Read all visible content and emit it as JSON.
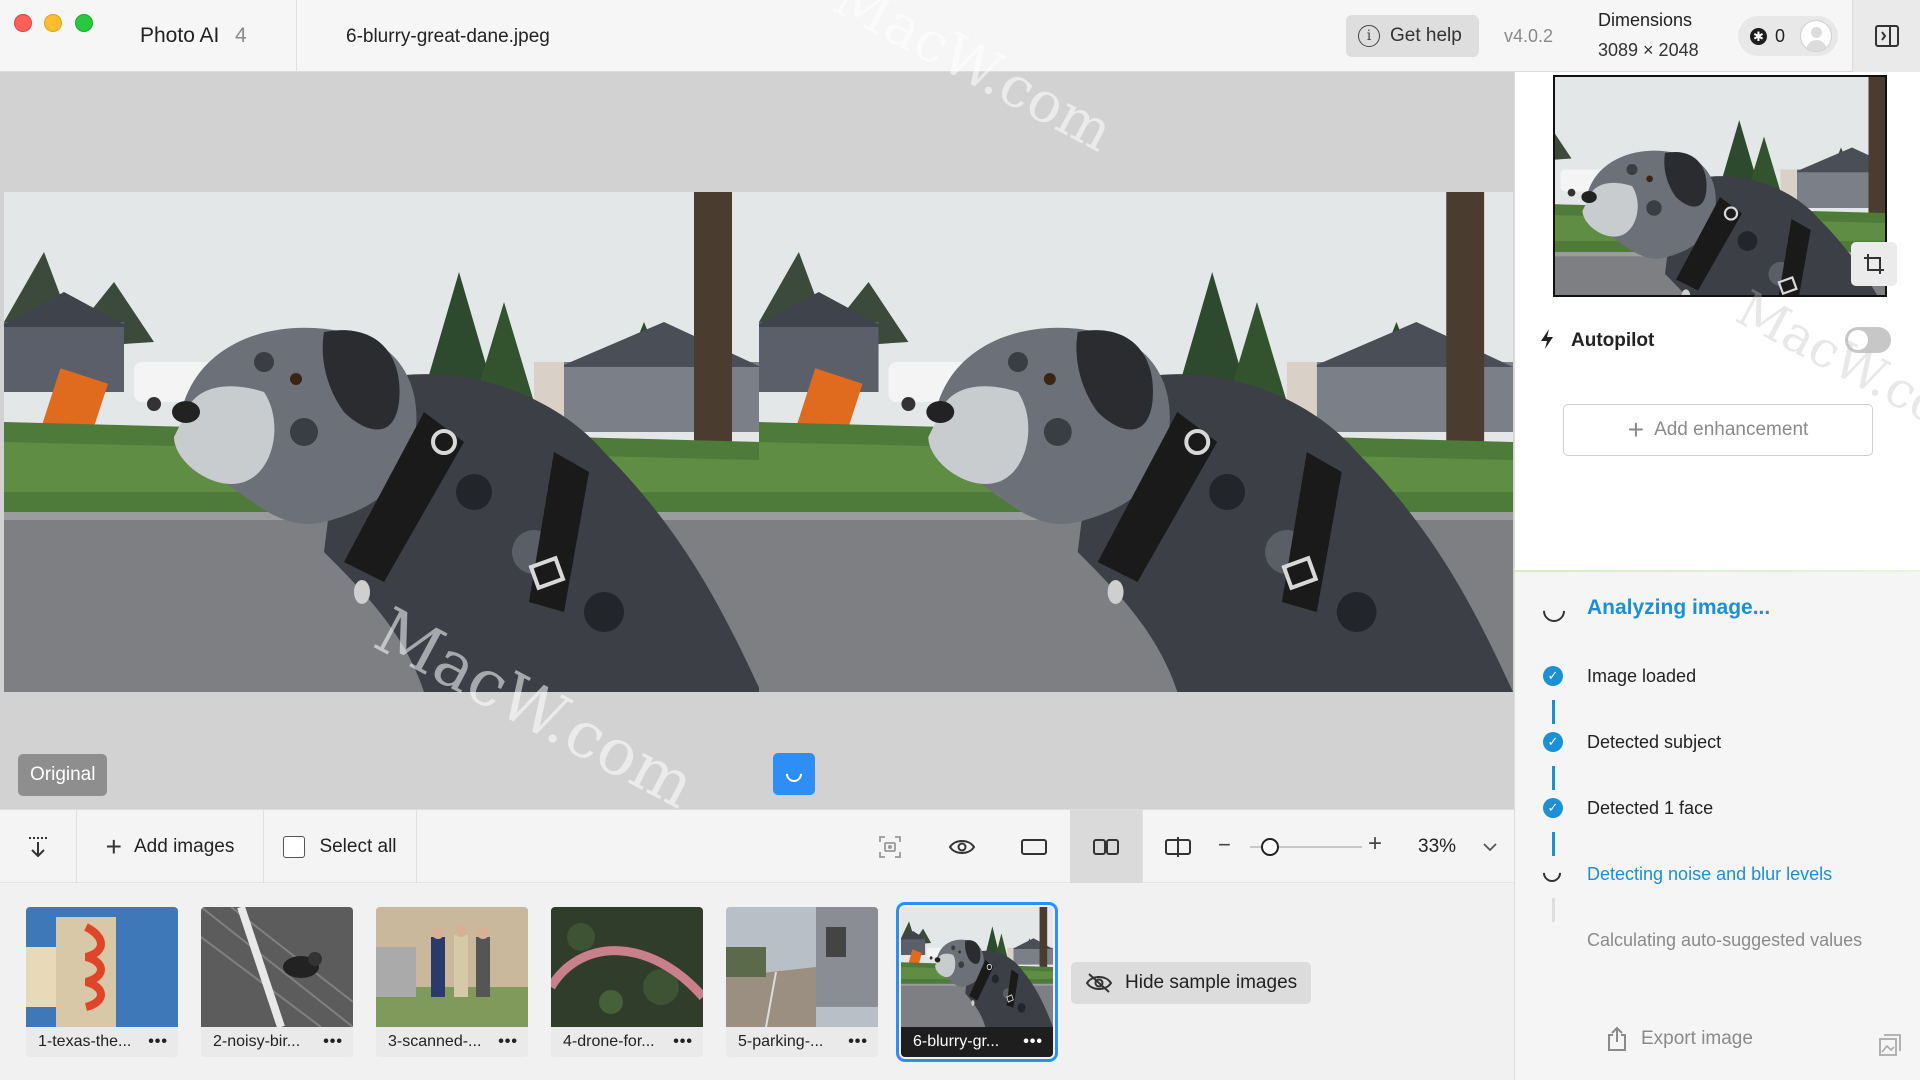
{
  "titlebar": {
    "app_name": "Photo AI",
    "app_version_badge": "4",
    "file_name": "6-blurry-great-dane.jpeg",
    "help_label": "Get help",
    "version": "v4.0.2",
    "dimensions_title": "Dimensions",
    "dimensions_value": "3089 × 2048",
    "credits": "0"
  },
  "canvas": {
    "original_label": "Original",
    "watermark_text": "MacW.com"
  },
  "toolbar": {
    "add_images_label": "Add images",
    "select_all_label": "Select all",
    "zoom_value": "33%",
    "zoom_level": 0.18
  },
  "filmstrip": {
    "thumbnails": [
      {
        "label": "1-texas-the...",
        "selected": false
      },
      {
        "label": "2-noisy-bir...",
        "selected": false
      },
      {
        "label": "3-scanned-...",
        "selected": false
      },
      {
        "label": "4-drone-for...",
        "selected": false
      },
      {
        "label": "5-parking-...",
        "selected": false
      },
      {
        "label": "6-blurry-gr...",
        "selected": true
      }
    ],
    "hide_samples_label": "Hide sample images"
  },
  "panel": {
    "autopilot_label": "Autopilot",
    "autopilot_on": false,
    "add_enhancement_label": "Add enhancement",
    "analyzing_title": "Analyzing image...",
    "steps": [
      {
        "label": "Image loaded",
        "status": "done"
      },
      {
        "label": "Detected subject",
        "status": "done"
      },
      {
        "label": "Detected 1 face",
        "status": "done"
      },
      {
        "label": "Detecting noise and blur levels",
        "status": "active"
      },
      {
        "label": "Calculating auto-suggested values",
        "status": "pending"
      }
    ],
    "export_label": "Export image"
  },
  "colors": {
    "accent": "#1d8fd4",
    "selection": "#2f8ef5",
    "canvas_bg": "#d2d2d2"
  },
  "icons": [
    "info-icon",
    "coin-icon",
    "avatar",
    "sidebar-toggle-icon",
    "crop-icon",
    "bolt-icon",
    "plus-icon",
    "download-icon",
    "screenshot-icon",
    "eye-icon",
    "single-view-icon",
    "side-by-side-icon",
    "split-view-icon",
    "chevron-down-icon",
    "eye-off-icon",
    "export-icon",
    "gallery-icon"
  ]
}
